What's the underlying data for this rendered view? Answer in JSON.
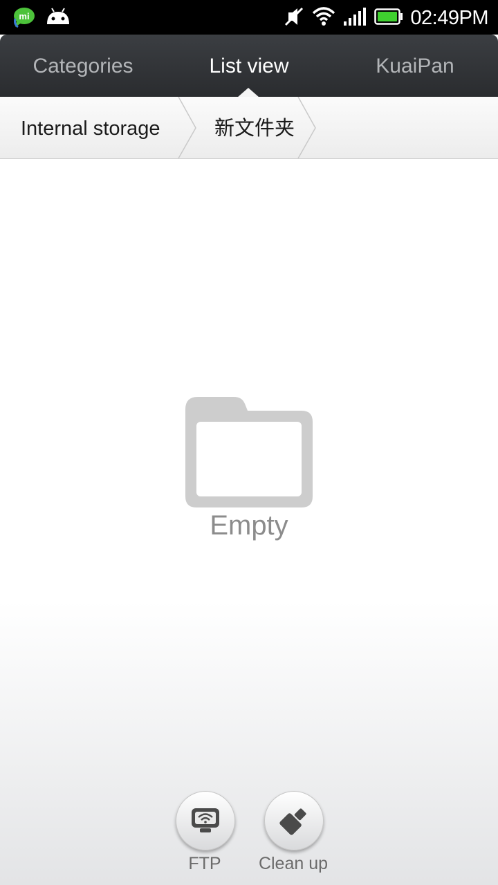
{
  "status_bar": {
    "time": "02:49PM",
    "left_icons": [
      "mi-talk-icon",
      "android-icon"
    ],
    "right_icons": [
      "mute-icon",
      "wifi-icon",
      "signal-icon",
      "battery-icon"
    ],
    "battery_level": 1.0,
    "battery_color": "#3fd12f"
  },
  "tabs": [
    {
      "label": "Categories",
      "active": false
    },
    {
      "label": "List view",
      "active": true
    },
    {
      "label": "KuaiPan",
      "active": false
    }
  ],
  "breadcrumb": [
    "Internal storage",
    "新文件夹"
  ],
  "empty_state": {
    "icon": "folder-icon",
    "text": "Empty"
  },
  "actions": [
    {
      "label": "FTP",
      "icon": "ftp-monitor-icon"
    },
    {
      "label": "Clean up",
      "icon": "broom-icon"
    }
  ]
}
